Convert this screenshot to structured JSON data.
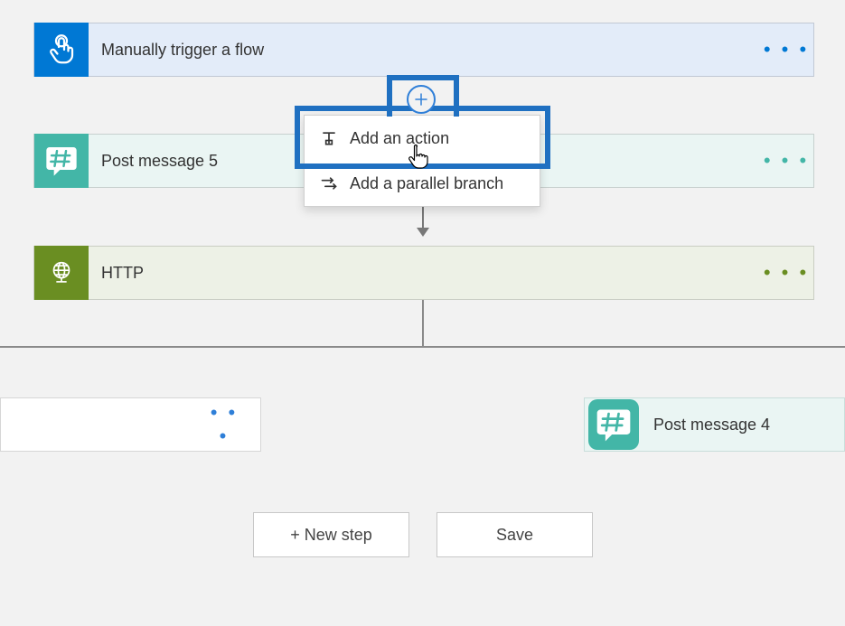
{
  "steps": {
    "trigger": {
      "title": "Manually trigger a flow"
    },
    "post5": {
      "title": "Post message 5"
    },
    "http": {
      "title": "HTTP"
    },
    "post4": {
      "title": "Post message 4"
    }
  },
  "menu": {
    "add_action": "Add an action",
    "add_parallel": "Add a parallel branch"
  },
  "buttons": {
    "new_step": "+ New step",
    "save": "Save"
  },
  "glyphs": {
    "ellipsis": "• • •"
  }
}
